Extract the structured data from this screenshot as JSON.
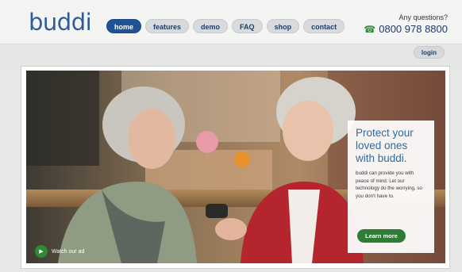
{
  "brand": {
    "logo_text": "buddi"
  },
  "nav": {
    "items": [
      {
        "label": "home",
        "active": true
      },
      {
        "label": "features",
        "active": false
      },
      {
        "label": "demo",
        "active": false
      },
      {
        "label": "FAQ",
        "active": false
      },
      {
        "label": "shop",
        "active": false
      },
      {
        "label": "contact",
        "active": false
      }
    ]
  },
  "contact": {
    "questions": "Any questions?",
    "phone": "0800 978 8800",
    "phone_icon": "phone-icon"
  },
  "account": {
    "login_label": "login"
  },
  "promo": {
    "title": "Protect your loved ones with buddi.",
    "body": "buddi can provide you with peace of mind. Let our technology do the worrying, so you don't have to.",
    "cta_label": "Learn more"
  },
  "video": {
    "label": "Watch our ad",
    "icon": "play-icon"
  },
  "colors": {
    "brand_blue": "#1f5393",
    "accent_green": "#2f7d34",
    "logo_blue": "#2c5d97"
  }
}
